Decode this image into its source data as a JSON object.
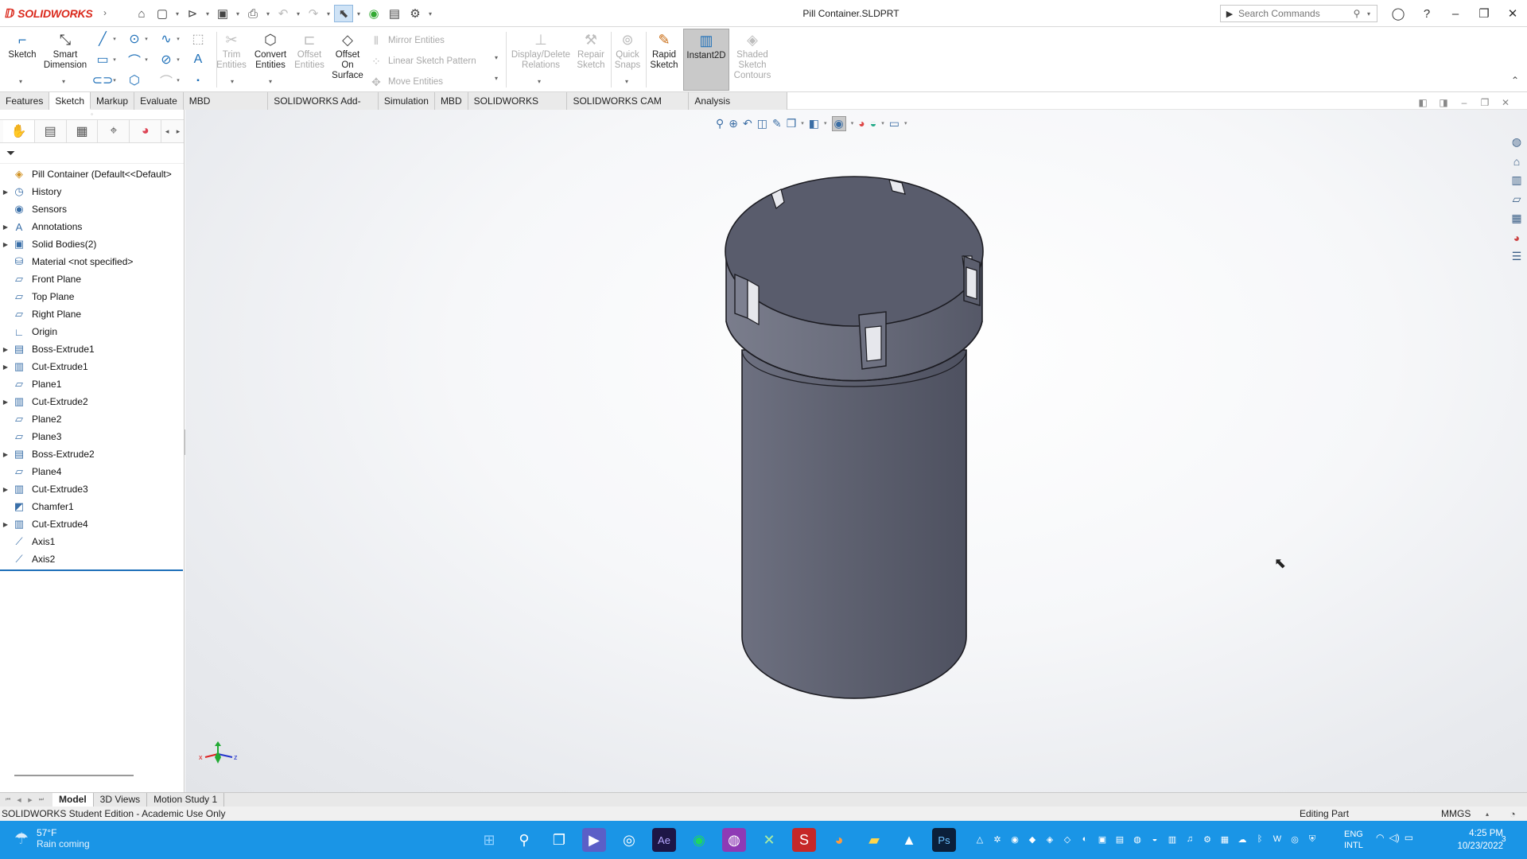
{
  "app": {
    "logo_text": "SOLIDWORKS",
    "doc_title": "Pill Container.SLDPRT",
    "search_placeholder": "Search Commands"
  },
  "quick_access": [
    "home-icon",
    "new-document-icon",
    "open-icon",
    "save-icon",
    "print-icon",
    "undo-icon",
    "redo-icon",
    "select-arrow-icon",
    "rebuild-icon",
    "file-properties-icon",
    "options-gear-icon"
  ],
  "ribbon": {
    "sketch": "Sketch",
    "smart_dimension_1": "Smart",
    "smart_dimension_2": "Dimension",
    "trim_1": "Trim",
    "trim_2": "Entities",
    "convert_1": "Convert",
    "convert_2": "Entities",
    "offset_1": "Offset",
    "offset_2": "Entities",
    "offset_surface_1": "Offset",
    "offset_surface_2": "On",
    "offset_surface_3": "Surface",
    "mirror": "Mirror Entities",
    "linear_pattern": "Linear Sketch Pattern",
    "move": "Move Entities",
    "display_delete_1": "Display/Delete",
    "display_delete_2": "Relations",
    "repair_1": "Repair",
    "repair_2": "Sketch",
    "quick_snaps_1": "Quick",
    "quick_snaps_2": "Snaps",
    "rapid_1": "Rapid",
    "rapid_2": "Sketch",
    "instant2d": "Instant2D",
    "shaded_1": "Shaded",
    "shaded_2": "Sketch",
    "shaded_3": "Contours"
  },
  "tabs": [
    "Features",
    "Sketch",
    "Markup",
    "Evaluate",
    "MBD Dimensions",
    "SOLIDWORKS Add-Ins",
    "Simulation",
    "MBD",
    "SOLIDWORKS CAM",
    "SOLIDWORKS CAM TBM",
    "Analysis Preparation"
  ],
  "tree": [
    {
      "label": "Pill Container  (Default<<Default>",
      "expand": false,
      "icon": "part-icon"
    },
    {
      "label": "History",
      "expand": true,
      "icon": "history-icon"
    },
    {
      "label": "Sensors",
      "expand": false,
      "icon": "sensors-icon"
    },
    {
      "label": "Annotations",
      "expand": true,
      "icon": "annotations-icon"
    },
    {
      "label": "Solid Bodies(2)",
      "expand": true,
      "icon": "solid-bodies-icon"
    },
    {
      "label": "Material <not specified>",
      "expand": false,
      "icon": "material-icon"
    },
    {
      "label": "Front Plane",
      "expand": false,
      "icon": "plane-icon"
    },
    {
      "label": "Top Plane",
      "expand": false,
      "icon": "plane-icon"
    },
    {
      "label": "Right Plane",
      "expand": false,
      "icon": "plane-icon"
    },
    {
      "label": "Origin",
      "expand": false,
      "icon": "origin-icon"
    },
    {
      "label": "Boss-Extrude1",
      "expand": true,
      "icon": "boss-extrude-icon"
    },
    {
      "label": "Cut-Extrude1",
      "expand": true,
      "icon": "cut-extrude-icon"
    },
    {
      "label": "Plane1",
      "expand": false,
      "icon": "plane-icon"
    },
    {
      "label": "Cut-Extrude2",
      "expand": true,
      "icon": "cut-extrude-icon"
    },
    {
      "label": "Plane2",
      "expand": false,
      "icon": "plane-icon"
    },
    {
      "label": "Plane3",
      "expand": false,
      "icon": "plane-icon"
    },
    {
      "label": "Boss-Extrude2",
      "expand": true,
      "icon": "boss-extrude-icon"
    },
    {
      "label": "Plane4",
      "expand": false,
      "icon": "plane-icon"
    },
    {
      "label": "Cut-Extrude3",
      "expand": true,
      "icon": "cut-extrude-icon"
    },
    {
      "label": "Chamfer1",
      "expand": false,
      "icon": "chamfer-icon"
    },
    {
      "label": "Cut-Extrude4",
      "expand": true,
      "icon": "cut-extrude-icon"
    },
    {
      "label": "Axis1",
      "expand": false,
      "icon": "axis-icon"
    },
    {
      "label": "Axis2",
      "expand": false,
      "icon": "axis-icon"
    }
  ],
  "bottom_tabs": [
    "Model",
    "3D Views",
    "Motion Study 1"
  ],
  "status": {
    "left": "SOLIDWORKS Student Edition - Academic Use Only",
    "mode": "Editing Part",
    "units": "MMGS"
  },
  "taskbar": {
    "temperature": "57°F",
    "weather": "Rain coming",
    "lang_1": "ENG",
    "lang_2": "INTL",
    "time": "4:25 PM",
    "date": "10/23/2022",
    "notifications": "3"
  },
  "colors": {
    "accent": "#1d6fb8",
    "brand": "#da291c",
    "taskbar": "#1a95e6",
    "model": "#6a6f80"
  }
}
